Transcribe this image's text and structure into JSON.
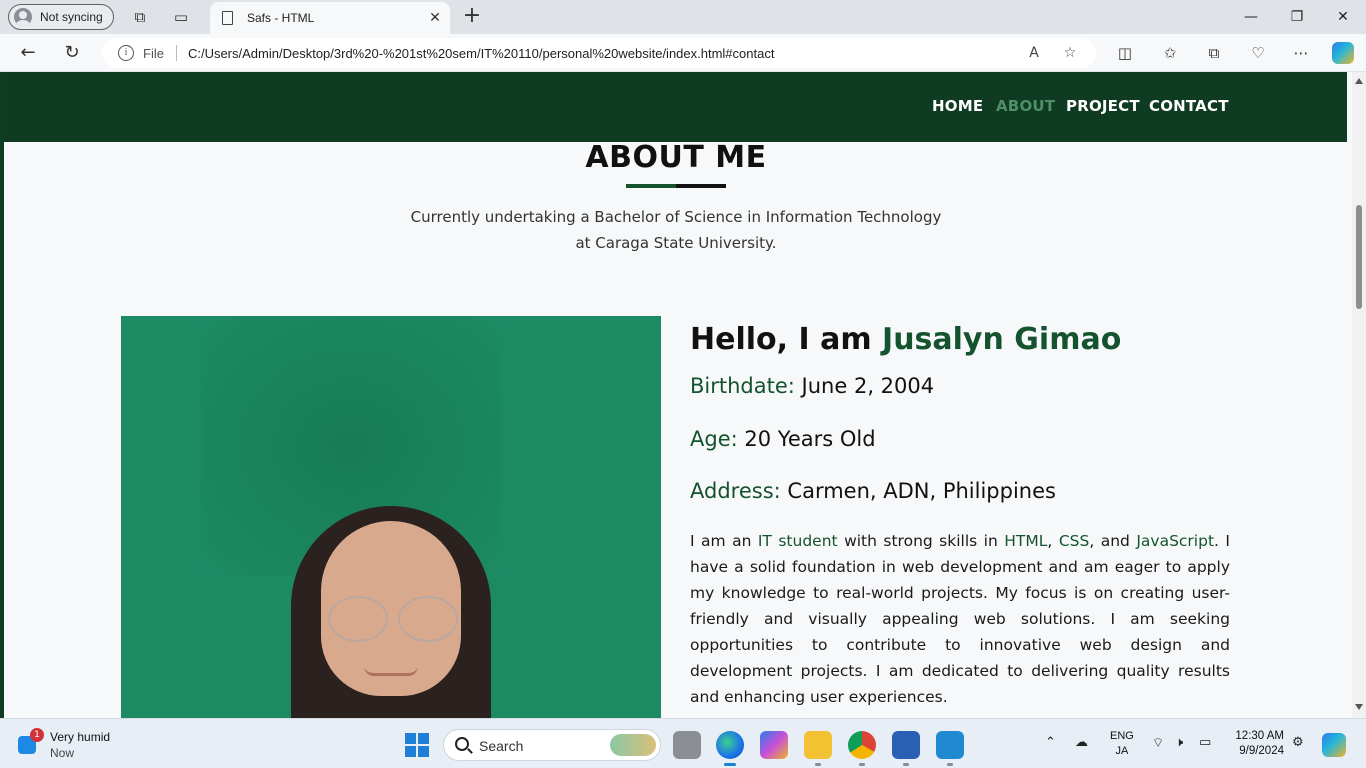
{
  "browser": {
    "profile_label": "Not syncing",
    "tab_title": "Safs - HTML",
    "file_label": "File",
    "url": "C:/Users/Admin/Desktop/3rd%20-%201st%20sem/IT%20110/personal%20website/index.html#contact"
  },
  "site": {
    "nav": {
      "home": "HOME",
      "about": "ABOUT",
      "project": "PROJECT",
      "contact": "CONTACT"
    },
    "about": {
      "title": "ABOUT ME",
      "subtitle_line1": "Currently undertaking a Bachelor of Science in Information Technology",
      "subtitle_line2": "at Caraga State University.",
      "hello_prefix": "Hello, I am ",
      "name": "Jusalyn Gimao",
      "birthdate_label": "Birthdate:",
      "birthdate_value": "June 2, 2004",
      "age_label": "Age:",
      "age_value": "20 Years Old",
      "address_label": "Address:",
      "address_value": "Carmen, ADN, Philippines",
      "bio": {
        "p1": "I am an ",
        "hl1": "IT student",
        "p2": " with strong skills in ",
        "hl2": "HTML",
        "p3": ", ",
        "hl3": "CSS",
        "p4": ", and ",
        "hl4": "JavaScript",
        "p5": ". I have a solid foundation in web development and am eager to apply my knowledge to real-world projects. My focus is on creating user-friendly and visually appealing web solutions. I am seeking opportunities to contribute to innovative web design and development projects. I am dedicated to delivering quality results and enhancing user experiences."
      }
    }
  },
  "taskbar": {
    "weather_text": "Very humid",
    "weather_sub": "Now",
    "weather_badge": "1",
    "search_label": "Search",
    "lang_1": "ENG",
    "lang_2": "JA",
    "time": "12:30 AM",
    "date": "9/9/2024"
  },
  "colors": {
    "nav_bg": "#0e3b22",
    "accent_green": "#15532f",
    "photo_bg": "#1c8b64"
  }
}
